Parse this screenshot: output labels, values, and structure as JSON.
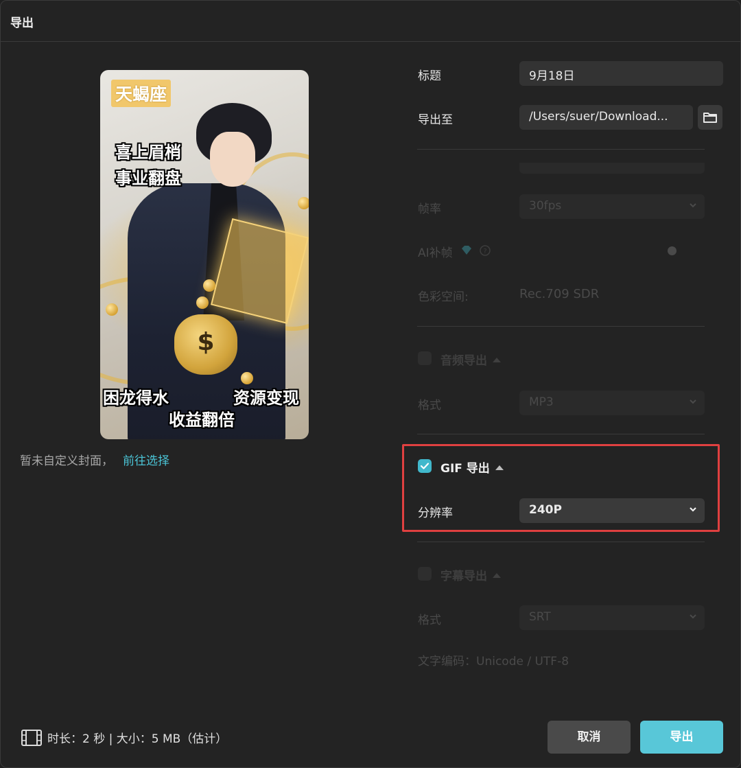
{
  "window": {
    "title": "导出"
  },
  "cover": {
    "badge": "天蝎座",
    "caption_1": "喜上眉梢",
    "caption_2": "事业翻盘",
    "caption_3": "困龙得水",
    "caption_4": "资源变现",
    "caption_5": "收益翻倍",
    "bag_symbol": "$",
    "note": "暂未自定义封面，",
    "note_link": "前往选择"
  },
  "form": {
    "title_label": "标题",
    "title_value": "9月18日",
    "export_to_label": "导出至",
    "export_to_value": "/Users/suer/Download...",
    "framerate_label": "帧率",
    "framerate_value": "30fps",
    "ai_frame_label": "AI补帧",
    "colorspace_label": "色彩空间:",
    "colorspace_value": "Rec.709 SDR",
    "audio_section": "音频导出",
    "audio_format_label": "格式",
    "audio_format_value": "MP3",
    "gif_section": "GIF 导出",
    "gif_checked": true,
    "resolution_label": "分辨率",
    "resolution_value": "240P",
    "subtitle_section": "字幕导出",
    "subtitle_format_label": "格式",
    "subtitle_format_value": "SRT",
    "encoding_text": "文字编码：Unicode / UTF-8"
  },
  "footer": {
    "info": "时长：2 秒 | 大小：5 MB（估计）",
    "cancel": "取消",
    "export": "导出"
  },
  "colors": {
    "accent": "#58c7d8",
    "highlight": "#e04040",
    "link": "#4bc4d6"
  }
}
